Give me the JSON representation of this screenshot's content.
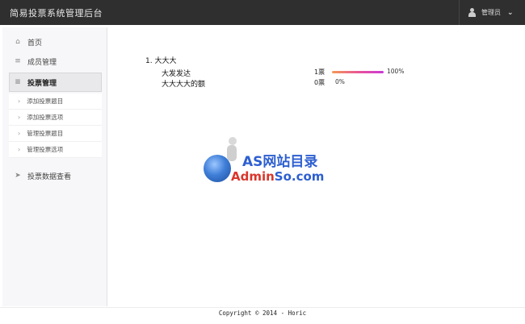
{
  "header": {
    "title": "简易投票系统管理后台",
    "user": "管理员"
  },
  "sidebar": {
    "items": [
      {
        "label": "首页",
        "icon": "home-icon"
      },
      {
        "label": "成员管理",
        "icon": "list-icon"
      },
      {
        "label": "投票管理",
        "icon": "list-icon",
        "sub": [
          "添加投票题目",
          "添加投票选项",
          "管理投票题目",
          "管理投票选项"
        ]
      },
      {
        "label": "投票数据查看",
        "icon": "send-icon"
      }
    ]
  },
  "poll": {
    "question": "1. 大大大",
    "options": [
      {
        "label": "大发发达",
        "votes": "1票",
        "percent_text": "100%",
        "percent": 100
      },
      {
        "label": "大大大大的额",
        "votes": "0票",
        "percent_text": "0%",
        "percent": 0
      }
    ]
  },
  "watermark": {
    "line1": "AS网站目录",
    "line2_a": "Admin",
    "line2_b": "So.com"
  },
  "footer": {
    "text": "Copyright © 2014 - Horic"
  },
  "colors": {
    "topbar": "#2f2f2f",
    "bar_start": "#f39a55",
    "bar_end": "#c93bd6",
    "brand_blue": "#2d5fd0"
  }
}
